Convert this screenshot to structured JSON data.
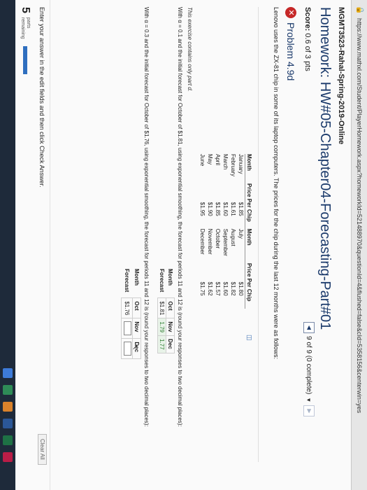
{
  "browser": {
    "url": "https://www.mathxl.com/Student/PlayerHomework.aspx?homeworkId=521488970&questionId=4&flushed=false&cId=5358156&centerwin=yes"
  },
  "course": "MGMT3523-Rahal-Spring-2019-Online",
  "homework": {
    "title": "Homework: HW#05-Chapter04-Forecasting-Part#01",
    "score_label": "Score:",
    "score_value": "0.6 of 3 pts",
    "nav_text": "9 of 9 (0 complete)",
    "nav_prev": "◀",
    "nav_next": "▶",
    "nav_dropdown": "▼"
  },
  "problem": {
    "title": "Problem 4.9d",
    "status_icon": "x-icon",
    "intro": "Lenovo uses the ZX-81 chip in some of its laptop computers. The prices for the chip during the last 12 months were as follows:",
    "table": {
      "headers": [
        "Month",
        "Price Per Chip",
        "Month",
        "Price Per Chip"
      ],
      "rows": [
        [
          "January",
          "$1.85",
          "July",
          "$1.80"
        ],
        [
          "February",
          "$1.61",
          "August",
          "$1.82"
        ],
        [
          "March",
          "$1.60",
          "September",
          "$1.60"
        ],
        [
          "April",
          "$1.85",
          "October",
          "$1.57"
        ],
        [
          "May",
          "$1.90",
          "November",
          "$1.62"
        ],
        [
          "June",
          "$1.95",
          "December",
          "$1.75"
        ]
      ]
    },
    "note": "This exercise contains only part d.",
    "q1_text": "With α = 0.1 and the initial forecast for October of $1.81, using exponential smoothing, the forecast for periods 11 and 12 is (round your responses to two decimal places):",
    "q1_table": {
      "month_label": "Month",
      "forecast_label": "Forecast",
      "months": [
        "Oct",
        "Nov",
        "Dec"
      ],
      "values": [
        "$1.81",
        "1.79",
        "1.77"
      ]
    },
    "q2_text": "With α = 0.3 and the initial forecast for October of $1.76, using exponential smoothing, the forecast for periods 11 and 12 is (round your responses to two decimal places):",
    "q2_table": {
      "month_label": "Month",
      "forecast_label": "Forecast",
      "months": [
        "Oct",
        "Nov",
        "Dec"
      ],
      "first_value": "$1.76"
    }
  },
  "footer": {
    "instruction": "Enter your answer in the edit fields and then click Check Answer.",
    "clear_all": "Clear All",
    "parts_count": "5",
    "parts_label_1": "parts",
    "parts_label_2": "remaining"
  }
}
